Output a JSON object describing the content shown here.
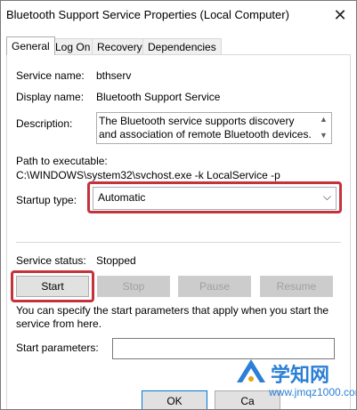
{
  "window": {
    "title": "Bluetooth Support Service Properties (Local Computer)",
    "close_glyph": "✕"
  },
  "tabs": [
    {
      "label": "General",
      "active": true
    },
    {
      "label": "Log On"
    },
    {
      "label": "Recovery"
    },
    {
      "label": "Dependencies"
    }
  ],
  "general": {
    "service_name_label": "Service name:",
    "service_name": "bthserv",
    "display_name_label": "Display name:",
    "display_name": "Bluetooth Support Service",
    "description_label": "Description:",
    "description": "The Bluetooth service supports discovery and association of remote Bluetooth devices.  Stopping",
    "path_label": "Path to executable:",
    "path": "C:\\WINDOWS\\system32\\svchost.exe -k LocalService -p",
    "startup_type_label": "Startup type:",
    "startup_type": "Automatic",
    "service_status_label": "Service status:",
    "service_status": "Stopped",
    "start_label": "Start",
    "stop_label": "Stop",
    "pause_label": "Pause",
    "resume_label": "Resume",
    "hint": "You can specify the start parameters that apply when you start the service from here.",
    "start_params_label": "Start parameters:",
    "start_params_value": ""
  },
  "footer": {
    "ok_label": "OK",
    "cancel_label": "Ca"
  },
  "watermark": {
    "text": "学知网",
    "url": "www.jmqz1000.com"
  },
  "colors": {
    "highlight": "#c4333c",
    "watermark": "#2b7fd6"
  }
}
